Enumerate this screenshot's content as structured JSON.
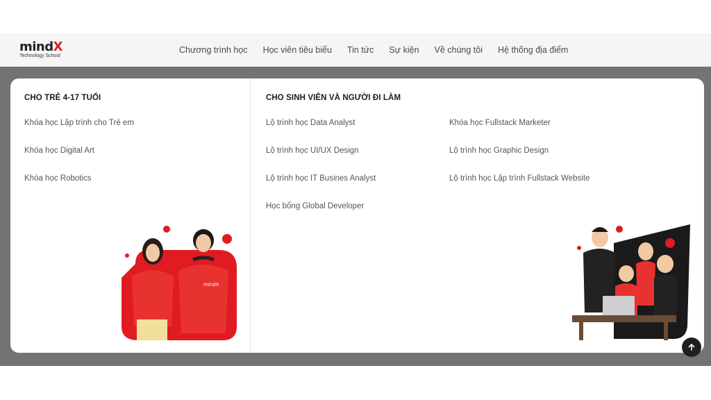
{
  "brand": {
    "logo_main": "mind",
    "logo_x": "X",
    "logo_sub": "Technology School"
  },
  "nav": {
    "items": [
      {
        "label": "Chương trình học"
      },
      {
        "label": "Học viên tiêu biểu"
      },
      {
        "label": "Tin tức"
      },
      {
        "label": "Sự kiện"
      },
      {
        "label": "Về chúng tôi"
      },
      {
        "label": "Hệ thống địa điểm"
      }
    ]
  },
  "menu": {
    "kids": {
      "title": "CHO TRẺ 4-17 TUỔI",
      "items": [
        {
          "label": "Khóa học Lập trình cho Trẻ em"
        },
        {
          "label": "Khóa học Digital Art"
        },
        {
          "label": "Khóa học Robotics"
        }
      ]
    },
    "adults": {
      "title": "CHO SINH VIÊN VÀ NGƯỜI ĐI LÀM",
      "items_left": [
        {
          "label": "Lộ trình học Data Analyst"
        },
        {
          "label": "Lộ trình học UI/UX Design"
        },
        {
          "label": "Lộ trình học IT Busines Analyst"
        },
        {
          "label": "Học bổng Global Developer"
        }
      ],
      "items_right": [
        {
          "label": "Khóa học Fullstack Marketer"
        },
        {
          "label": "Lộ trình học Graphic Design"
        },
        {
          "label": "Lộ trình học Lập trình Fullstack Website"
        }
      ]
    }
  },
  "icons": {
    "scroll_top": "arrow-up-icon"
  },
  "colors": {
    "brand_red": "#e11b22",
    "overlay": "#737373",
    "text_dark": "#1a1a1a",
    "text_muted": "#555555"
  }
}
